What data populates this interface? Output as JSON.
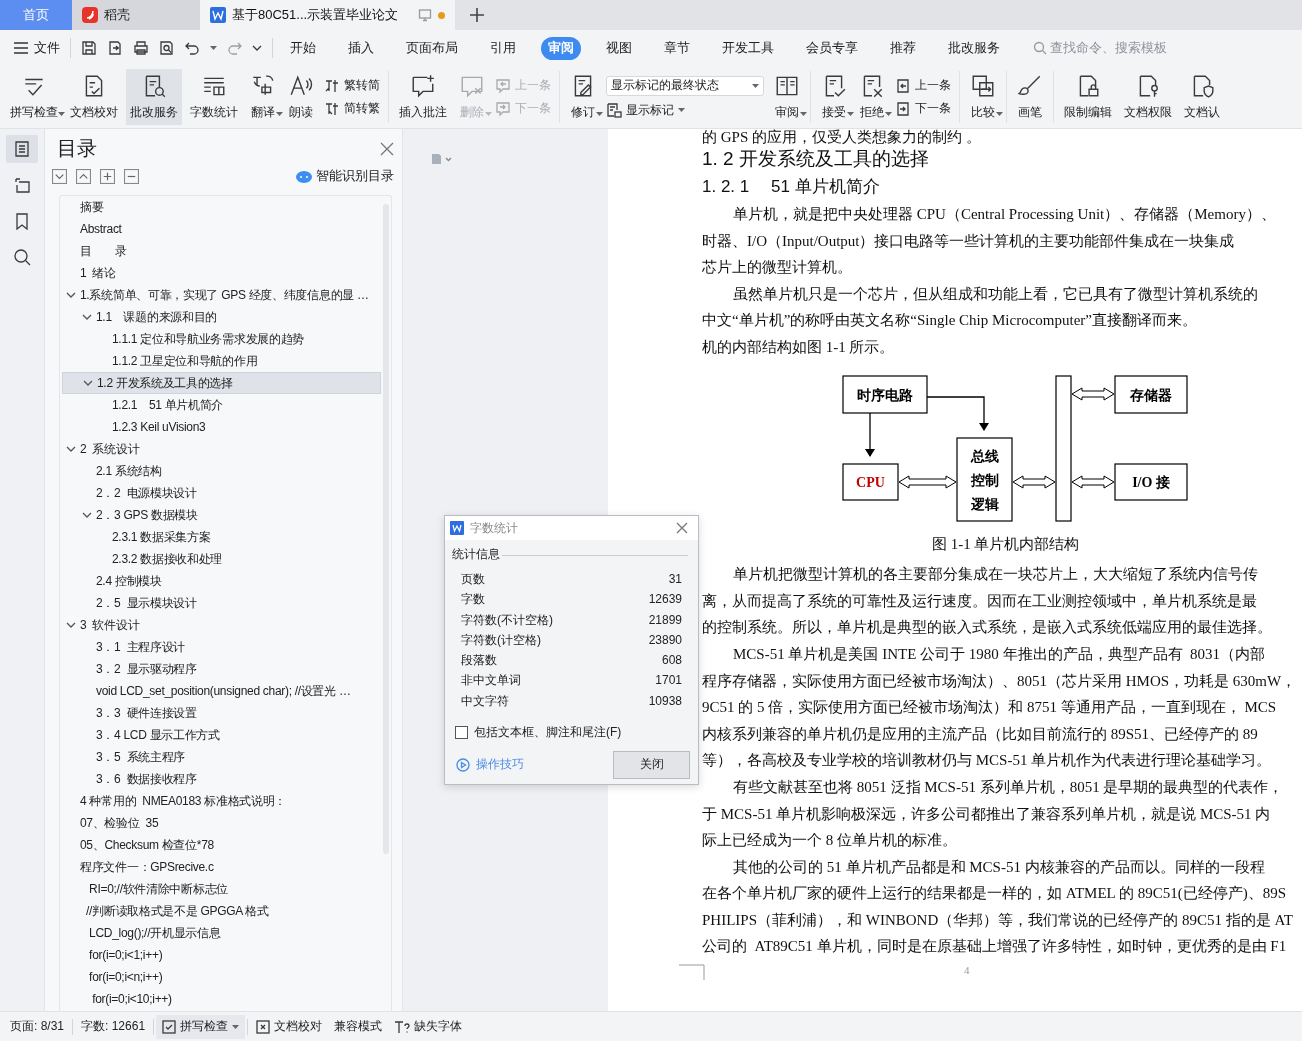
{
  "tabs": [
    {
      "label": "首页",
      "kind": "home",
      "selected": false,
      "modified": false
    },
    {
      "label": "稻壳",
      "kind": "app",
      "selected": false,
      "modified": false
    },
    {
      "label": "基于80C51...示装置毕业论文",
      "kind": "doc",
      "selected": true,
      "modified": true
    }
  ],
  "menu": {
    "file_label": "文件",
    "tabs": [
      {
        "label": "开始",
        "selected": false
      },
      {
        "label": "插入",
        "selected": false
      },
      {
        "label": "页面布局",
        "selected": false
      },
      {
        "label": "引用",
        "selected": false
      },
      {
        "label": "审阅",
        "selected": true
      },
      {
        "label": "视图",
        "selected": false
      },
      {
        "label": "章节",
        "selected": false
      },
      {
        "label": "开发工具",
        "selected": false
      },
      {
        "label": "会员专享",
        "selected": false
      },
      {
        "label": "推荐",
        "selected": false
      },
      {
        "label": "批改服务",
        "selected": false
      }
    ],
    "search": {
      "placeholder": "查找命令、搜索模板"
    }
  },
  "ribbon": {
    "groups": [
      {
        "items": [
          {
            "kind": "large",
            "label": "拼写检查",
            "dropdown": true,
            "disabled": false,
            "active": false
          },
          {
            "kind": "large",
            "label": "文档校对",
            "dropdown": false,
            "disabled": false,
            "active": false
          },
          {
            "kind": "large",
            "label": "批改服务",
            "dropdown": false,
            "disabled": false,
            "active": true
          },
          {
            "kind": "large",
            "label": "字数统计",
            "dropdown": false,
            "disabled": false,
            "active": false
          },
          {
            "kind": "large",
            "label": "翻译",
            "dropdown": true,
            "disabled": false,
            "active": false
          },
          {
            "kind": "large",
            "label": "朗读",
            "dropdown": false,
            "disabled": false,
            "active": false
          },
          {
            "kind": "stack",
            "items": [
              {
                "label": "繁转简",
                "disabled": false
              },
              {
                "label": "简转繁",
                "disabled": false
              }
            ]
          }
        ]
      },
      {
        "items": [
          {
            "kind": "large",
            "label": "插入批注",
            "dropdown": false,
            "disabled": false,
            "active": false
          },
          {
            "kind": "large",
            "label": "删除",
            "dropdown": true,
            "disabled": true,
            "active": false
          },
          {
            "kind": "stack",
            "items": [
              {
                "label": "上一条",
                "disabled": true
              },
              {
                "label": "下一条",
                "disabled": true
              }
            ]
          }
        ]
      },
      {
        "items": [
          {
            "kind": "large",
            "label": "修订",
            "dropdown": true,
            "disabled": false,
            "active": false
          },
          {
            "kind": "select",
            "value": "显示标记的最终状态",
            "button": {
              "label": "显示标记",
              "dropdown": true
            }
          },
          {
            "kind": "large",
            "label": "审阅",
            "dropdown": true,
            "disabled": false,
            "active": false
          }
        ]
      },
      {
        "items": [
          {
            "kind": "large",
            "label": "接受",
            "dropdown": true,
            "disabled": false,
            "active": false
          },
          {
            "kind": "large",
            "label": "拒绝",
            "dropdown": true,
            "disabled": false,
            "active": false
          },
          {
            "kind": "stack",
            "items": [
              {
                "label": "上一条",
                "disabled": false
              },
              {
                "label": "下一条",
                "disabled": false
              }
            ]
          }
        ]
      },
      {
        "items": [
          {
            "kind": "large",
            "label": "比较",
            "dropdown": true,
            "disabled": false,
            "active": false
          }
        ]
      },
      {
        "items": [
          {
            "kind": "large",
            "label": "画笔",
            "dropdown": false,
            "disabled": false,
            "active": false
          }
        ]
      },
      {
        "items": [
          {
            "kind": "large",
            "label": "限制编辑",
            "dropdown": false,
            "disabled": false,
            "active": false
          },
          {
            "kind": "large",
            "label": "文档权限",
            "dropdown": false,
            "disabled": false,
            "active": false
          },
          {
            "kind": "large",
            "label": "文档认",
            "dropdown": false,
            "disabled": false,
            "active": false
          }
        ]
      }
    ]
  },
  "sidebar": {
    "rail": [
      {
        "selected": true
      },
      {
        "selected": false
      },
      {
        "selected": false
      },
      {
        "selected": false
      }
    ],
    "title": "目录",
    "smart_label": "智能识别目录",
    "tree": [
      {
        "text": "摘要",
        "selected": false
      },
      {
        "text": "Abstract",
        "selected": false
      },
      {
        "text": "目　　录",
        "selected": false
      },
      {
        "text": "1  绪论",
        "selected": false
      },
      {
        "text": "1.系统简单、可靠，实现了 GPS 经度、纬度信息的显 …",
        "selected": false,
        "expanded": true,
        "children": [
          {
            "text": "1.1　课题的来源和目的",
            "selected": false,
            "expanded": true,
            "children": [
              {
                "text": "1.1.1 定位和导航业务需求发展的趋势",
                "selected": false
              },
              {
                "text": "1.1.2 卫星定位和导航的作用",
                "selected": false
              }
            ]
          },
          {
            "text": "1.2 开发系统及工具的选择",
            "selected": true,
            "expanded": true,
            "children": [
              {
                "text": "1.2.1　51 单片机简介",
                "selected": false
              },
              {
                "text": "1.2.3 Keil uVision3",
                "selected": false
              }
            ]
          }
        ]
      },
      {
        "text": "2  系统设计",
        "selected": false,
        "expanded": true,
        "children": [
          {
            "text": "2.1 系统结构",
            "selected": false
          },
          {
            "text": "2．2  电源模块设计",
            "selected": false
          },
          {
            "text": "2．3 GPS 数据模块",
            "selected": false,
            "expanded": true,
            "children": [
              {
                "text": "2.3.1 数据采集方案",
                "selected": false
              },
              {
                "text": "2.3.2 数据接收和处理",
                "selected": false
              }
            ]
          },
          {
            "text": "2.4 控制模块",
            "selected": false
          },
          {
            "text": "2．5  显示模块设计",
            "selected": false
          }
        ]
      },
      {
        "text": "3  软件设计",
        "selected": false,
        "expanded": true,
        "children": [
          {
            "text": "3．1  主程序设计",
            "selected": false
          },
          {
            "text": "3．2  显示驱动程序",
            "selected": false
          },
          {
            "text": "void LCD_set_position(unsigned char); //设置光 …",
            "selected": false
          },
          {
            "text": "3．3  硬件连接设置",
            "selected": false
          },
          {
            "text": "3．4 LCD 显示工作方式",
            "selected": false
          },
          {
            "text": "3．5  系统主程序",
            "selected": false
          },
          {
            "text": "3．6  数据接收程序",
            "selected": false
          }
        ]
      },
      {
        "text": "4 种常用的  NMEA0183 标准格式说明：",
        "selected": false
      },
      {
        "text": "07、检验位  35",
        "selected": false
      },
      {
        "text": "05、Checksum 检查位*78",
        "selected": false
      },
      {
        "text": "程序文件一：GPSrecive.c",
        "selected": false
      },
      {
        "text": "   RI=0;//软件清除中断标志位",
        "selected": false
      },
      {
        "text": "  //判断读取格式是不是 GPGGA 格式",
        "selected": false
      },
      {
        "text": "   LCD_log();//开机显示信息",
        "selected": false
      },
      {
        "text": "   for(i=0;i<1;i++)",
        "selected": false
      },
      {
        "text": "   for(i=0;i<n;i++)",
        "selected": false
      },
      {
        "text": "    for(i=0;i<10;i++)",
        "selected": false
      }
    ]
  },
  "document": {
    "lines_before": [
      {
        "kind": "cut",
        "text": "的 GPS 的应用，仅受人类想象力的制约 。"
      },
      {
        "kind": "h2",
        "text": "1. 2 开发系统及工具的选择"
      },
      {
        "kind": "h3",
        "text": "1. 2. 1　 51 单片机简介"
      },
      {
        "kind": "first",
        "text": "单片机，就是把中央处理器 CPU（Central Processing Unit）、存储器（Memory）、"
      },
      {
        "kind": "cont",
        "text": "时器、I/O（Input/Output）接口电路等一些计算机的主要功能部件集成在一块集成"
      },
      {
        "kind": "cont",
        "text": "芯片上的微型计算机。"
      },
      {
        "kind": "first",
        "text": "虽然单片机只是一个芯片，但从组成和功能上看，它已具有了微型计算机系统的"
      },
      {
        "kind": "cont",
        "text": "中文“单片机”的称呼由英文名称“Single Chip Microcomputer”直接翻译而来。"
      },
      {
        "kind": "cont",
        "text": "机的内部结构如图 1-1 所示。"
      }
    ],
    "diagram": {
      "boxes": [
        {
          "kind": "timing",
          "lines": [
            "时序电路"
          ]
        },
        {
          "kind": "memory",
          "lines": [
            "存储器"
          ]
        },
        {
          "kind": "cpu",
          "lines": [
            "CPU"
          ]
        },
        {
          "kind": "bus-control",
          "lines": [
            "总线",
            "控制",
            "逻辑"
          ]
        },
        {
          "kind": "io",
          "lines": [
            "I/O 接"
          ]
        }
      ],
      "caption": "图 1-1 单片机内部结构"
    },
    "lines_after": [
      {
        "kind": "first",
        "text": "单片机把微型计算机的各主要部分集成在一块芯片上，大大缩短了系统内信号传"
      },
      {
        "kind": "cont",
        "text": "离，从而提高了系统的可靠性及运行速度。因而在工业测控领域中，单片机系统是最"
      },
      {
        "kind": "cont",
        "text": "的控制系统。所以，单片机是典型的嵌入式系统，是嵌入式系统低端应用的最佳选择。"
      },
      {
        "kind": "first",
        "text": "MCS-51 单片机是美国 INTE 公司于 1980 年推出的产品，典型产品有  8031（内部"
      },
      {
        "kind": "cont",
        "text": "程序存储器，实际使用方面已经被市场淘汰）、8051（芯片采用 HMOS，功耗是 630mW，"
      },
      {
        "kind": "cont",
        "text": "9C51 的 5 倍，实际使用方面已经被市场淘汰）和 8751 等通用产品，一直到现在， MCS"
      },
      {
        "kind": "cont",
        "text": "内核系列兼容的单片机仍是应用的主流产品（比如目前流行的 89S51、已经停产的 89"
      },
      {
        "kind": "cont",
        "text": "等），各高校及专业学校的培训教材仍与 MCS-51 单片机作为代表进行理论基础学习。"
      },
      {
        "kind": "first",
        "text": "有些文献甚至也将 8051 泛指 MCS-51 系列单片机，8051 是早期的最典型的代表作，"
      },
      {
        "kind": "cont",
        "text": "于 MCS-51 单片机影响极深远，许多公司都推出了兼容系列单片机，就是说 MCS-51 内"
      },
      {
        "kind": "cont",
        "text": "际上已经成为一个 8 位单片机的标准。"
      },
      {
        "kind": "first",
        "text": "其他的公司的 51 单片机产品都是和 MCS-51 内核兼容的产品而以。同样的一段程"
      },
      {
        "kind": "cont",
        "text": "在各个单片机厂家的硬件上运行的结果都是一样的，如 ATMEL 的 89C51(已经停产)、89S"
      },
      {
        "kind": "cont",
        "text": "PHILIPS（菲利浦），和 WINBOND（华邦）等，我们常说的已经停产的 89C51 指的是 AT"
      },
      {
        "kind": "cont",
        "text": "公司的  AT89C51 单片机，同时是在原基础上增强了许多特性，如时钟，更优秀的是由 F1"
      }
    ],
    "page_number": "4"
  },
  "dialog": {
    "title": "字数统计",
    "section": "统计信息",
    "rows": [
      {
        "label": "页数",
        "value": "31"
      },
      {
        "label": "字数",
        "value": "12639"
      },
      {
        "label": "字符数(不计空格)",
        "value": "21899"
      },
      {
        "label": "字符数(计空格)",
        "value": "23890"
      },
      {
        "label": "段落数",
        "value": "608"
      },
      {
        "label": "非中文单词",
        "value": "1701"
      },
      {
        "label": "中文字符",
        "value": "10938"
      }
    ],
    "checkbox": {
      "label": "包括文本框、脚注和尾注(F)",
      "checked": false
    },
    "tips_link": "操作技巧",
    "close_button": "关闭"
  },
  "status_bar": [
    {
      "kind": "text",
      "label": "页面: 8/31"
    },
    {
      "kind": "text",
      "label": "字数: 12661"
    },
    {
      "kind": "spell",
      "label": "拼写检查",
      "active": true
    },
    {
      "kind": "proof",
      "label": "文档校对",
      "active": false
    },
    {
      "kind": "plain",
      "label": "兼容模式",
      "active": false
    },
    {
      "kind": "font",
      "label": "缺失字体",
      "active": false
    }
  ]
}
